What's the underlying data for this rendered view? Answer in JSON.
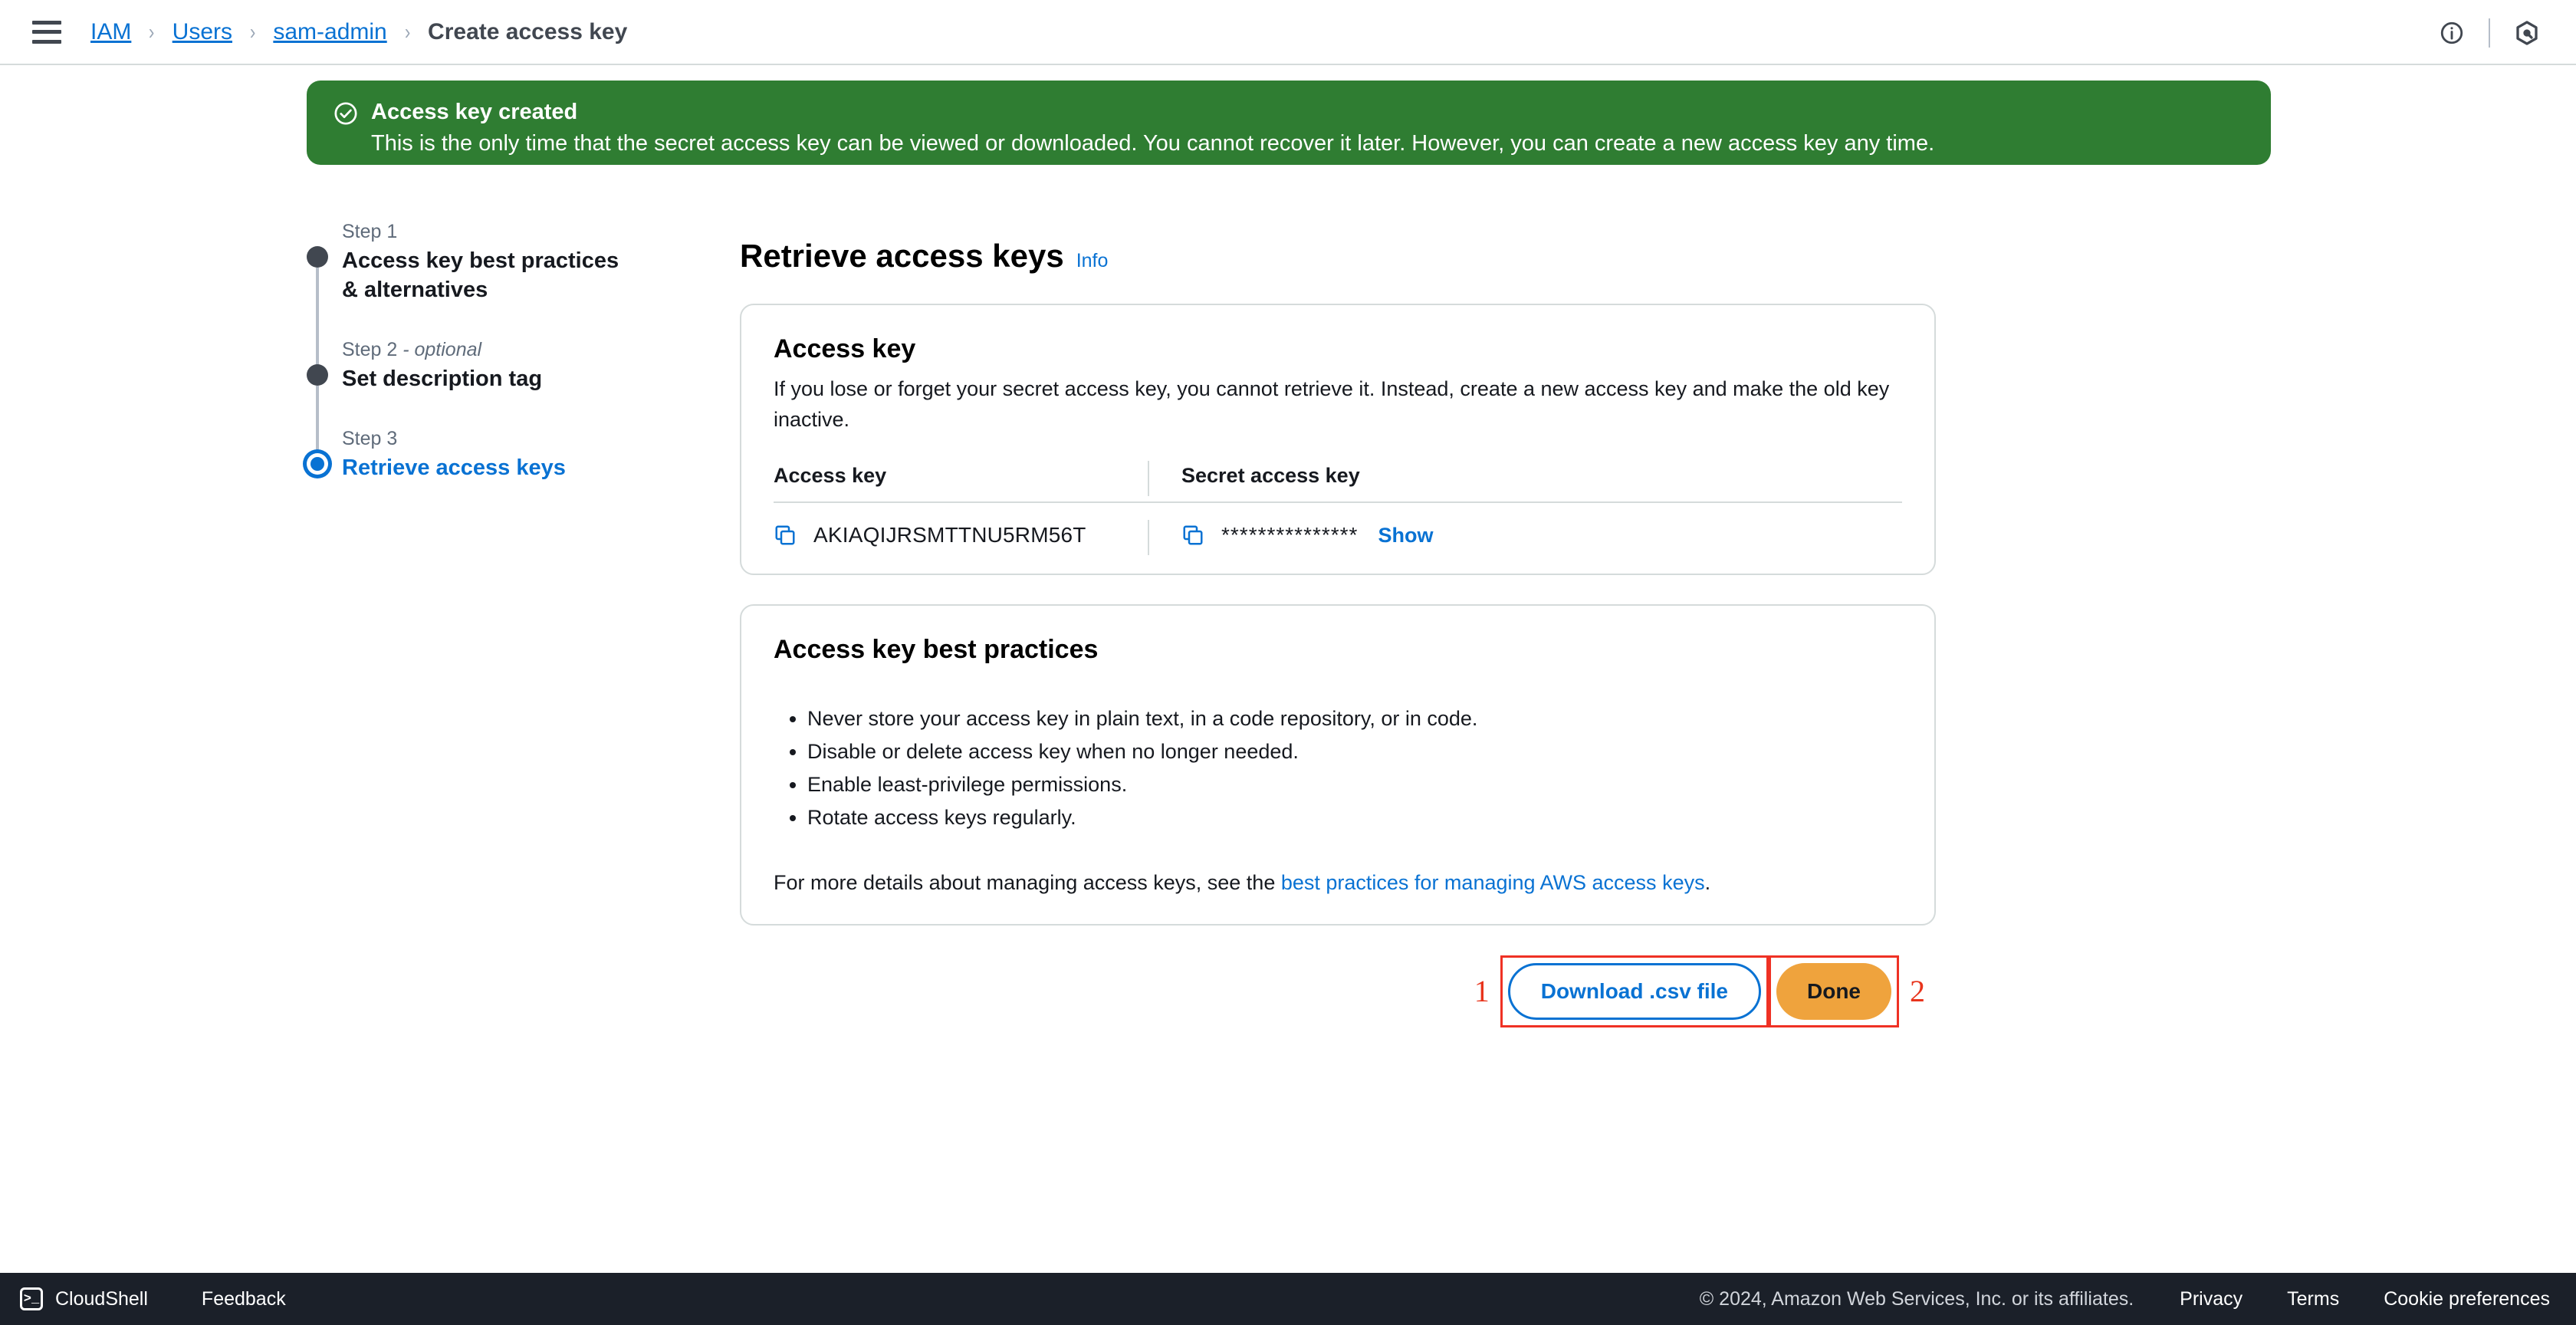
{
  "header": {
    "menu_icon": "hamburger-icon",
    "breadcrumb": [
      {
        "label": "IAM",
        "link": true
      },
      {
        "label": "Users",
        "link": true
      },
      {
        "label": "sam-admin",
        "link": true
      },
      {
        "label": "Create access key",
        "link": false
      }
    ],
    "separator": "›",
    "icons": [
      {
        "name": "info-circle-icon"
      },
      {
        "name": "aws-q-hexagon-icon"
      }
    ]
  },
  "flash": {
    "icon": "check-circle-icon",
    "title": "Access key created",
    "body": "This is the only time that the secret access key can be viewed or downloaded. You cannot recover it later. However, you can create a new access key any time.",
    "background_color": "#2f7d32"
  },
  "steps": [
    {
      "number": "Step 1",
      "optional": "",
      "title": "Access key best practices & alternatives",
      "active": false
    },
    {
      "number": "Step 2",
      "optional": " - optional",
      "title": "Set description tag",
      "active": false
    },
    {
      "number": "Step 3",
      "optional": "",
      "title": "Retrieve access keys",
      "active": true
    }
  ],
  "main": {
    "page_title": "Retrieve access keys",
    "info_label": "Info",
    "access_key_card": {
      "title": "Access key",
      "description": "If you lose or forget your secret access key, you cannot retrieve it. Instead, create a new access key and make the old key inactive.",
      "columns": [
        "Access key",
        "Secret access key"
      ],
      "access_key_value": "AKIAQIJRSMTTNU5RM56T",
      "secret_masked": "***************",
      "show_label": "Show",
      "copy_icon": "copy-icon"
    },
    "best_practices_card": {
      "title": "Access key best practices",
      "bullets": [
        "Never store your access key in plain text, in a code repository, or in code.",
        "Disable or delete access key when no longer needed.",
        "Enable least-privilege permissions.",
        "Rotate access keys regularly."
      ],
      "footer_prefix": "For more details about managing access keys, see the ",
      "footer_link": "best practices for managing AWS access keys",
      "footer_suffix": "."
    }
  },
  "actions": {
    "annotation_1": "1",
    "download_label": "Download .csv file",
    "annotation_2": "2",
    "done_label": "Done",
    "primary_color": "#efa33d",
    "annotation_color": "#ef3124"
  },
  "footer": {
    "cloudshell_icon": "cloudshell-terminal-icon",
    "cloudshell_label": "CloudShell",
    "feedback_label": "Feedback",
    "copyright": "© 2024, Amazon Web Services, Inc. or its affiliates.",
    "links": [
      "Privacy",
      "Terms",
      "Cookie preferences"
    ]
  }
}
